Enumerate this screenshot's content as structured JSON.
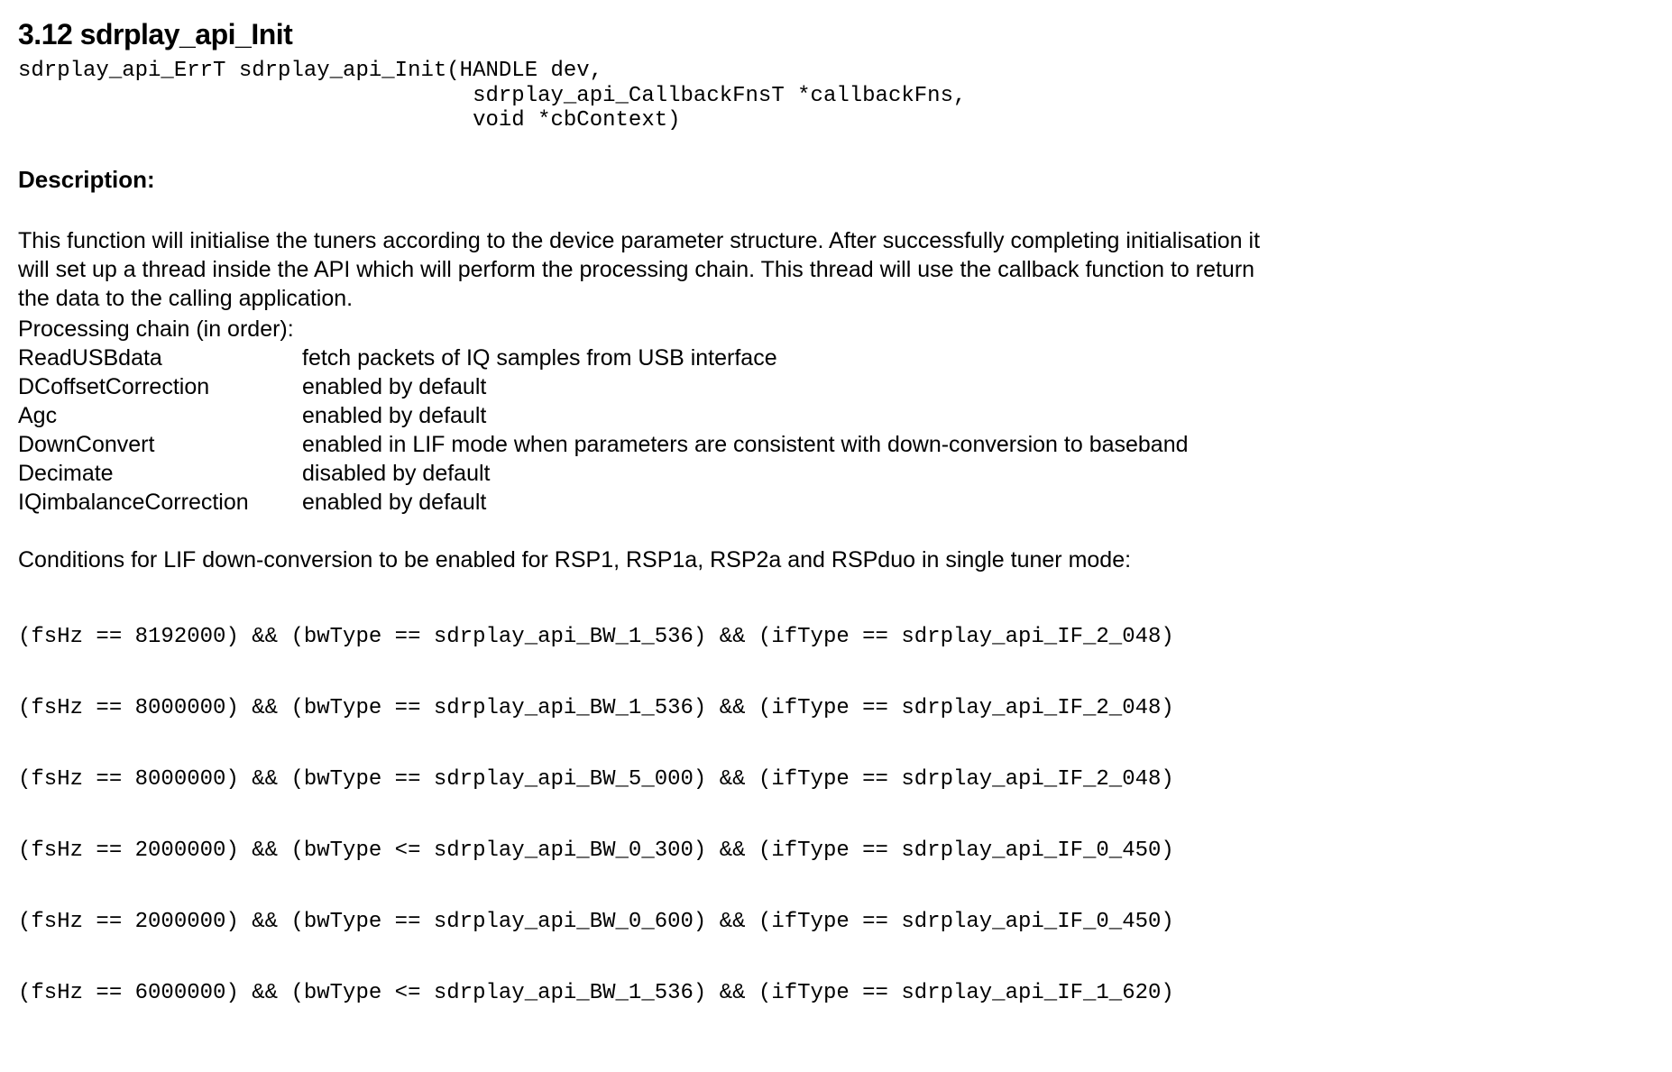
{
  "section": {
    "title": "3.12 sdrplay_api_Init",
    "signature": "sdrplay_api_ErrT sdrplay_api_Init(HANDLE dev,\n                                   sdrplay_api_CallbackFnsT *callbackFns,\n                                   void *cbContext)"
  },
  "description_heading": "Description:",
  "description_paragraph": "This function will initialise the tuners according to the device parameter structure. After successfully completing initialisation it will set up a thread inside the API which will perform the processing chain. This thread will use the callback function to return the data to the calling application.",
  "processing_chain_label": "Processing chain (in order):",
  "processing_chain": [
    {
      "name": "ReadUSBdata",
      "desc": "fetch packets of IQ samples from USB interface"
    },
    {
      "name": "DCoffsetCorrection",
      "desc": "enabled by default"
    },
    {
      "name": "Agc",
      "desc": "enabled by default"
    },
    {
      "name": "DownConvert",
      "desc": "enabled in LIF mode when parameters are consistent with down-conversion to baseband"
    },
    {
      "name": "Decimate",
      "desc": "disabled by default"
    },
    {
      "name": "IQimbalanceCorrection",
      "desc": "enabled by default"
    }
  ],
  "conditions_label": "Conditions for LIF down-conversion to be enabled for RSP1, RSP1a, RSP2a and RSPduo in single tuner mode:",
  "conditions": [
    "(fsHz == 8192000) && (bwType == sdrplay_api_BW_1_536) && (ifType == sdrplay_api_IF_2_048)",
    "(fsHz == 8000000) && (bwType == sdrplay_api_BW_1_536) && (ifType == sdrplay_api_IF_2_048)",
    "(fsHz == 8000000) && (bwType == sdrplay_api_BW_5_000) && (ifType == sdrplay_api_IF_2_048)",
    "(fsHz == 2000000) && (bwType <= sdrplay_api_BW_0_300) && (ifType == sdrplay_api_IF_0_450)",
    "(fsHz == 2000000) && (bwType == sdrplay_api_BW_0_600) && (ifType == sdrplay_api_IF_0_450)",
    "(fsHz == 6000000) && (bwType <= sdrplay_api_BW_1_536) && (ifType == sdrplay_api_IF_1_620)"
  ]
}
